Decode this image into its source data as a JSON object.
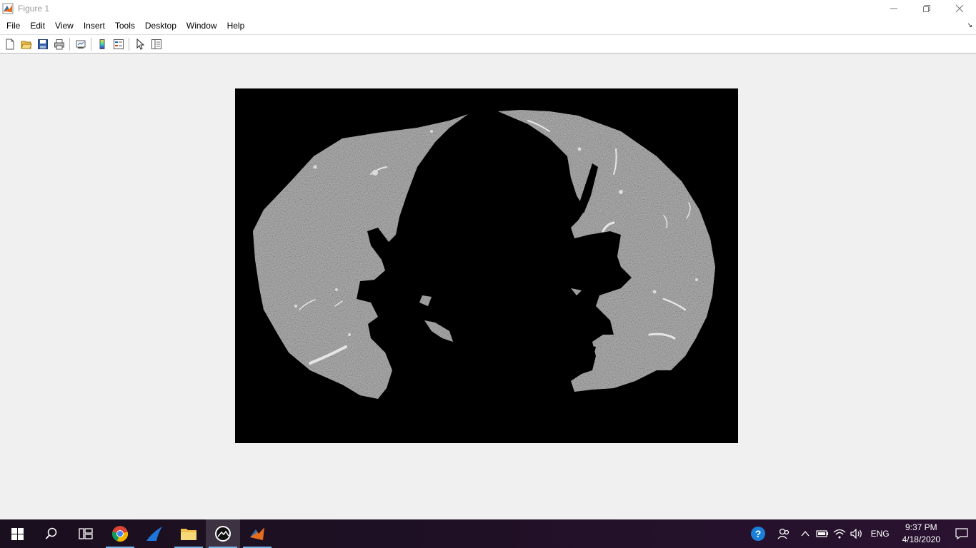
{
  "window": {
    "title": "Figure 1",
    "app_icon": "matlab-icon",
    "controls": [
      "minimize-icon",
      "restore-icon",
      "close-icon"
    ]
  },
  "menu": {
    "items": [
      {
        "label": "File"
      },
      {
        "label": "Edit"
      },
      {
        "label": "View"
      },
      {
        "label": "Insert"
      },
      {
        "label": "Tools"
      },
      {
        "label": "Desktop"
      },
      {
        "label": "Window"
      },
      {
        "label": "Help"
      }
    ]
  },
  "toolbar": {
    "buttons": [
      "new-figure-icon",
      "open-file-icon",
      "save-figure-icon",
      "print-figure-icon",
      "link-plot-icon",
      "insert-colorbar-icon",
      "insert-legend-icon",
      "edit-plot-icon",
      "open-property-inspector-icon"
    ]
  },
  "figure": {
    "content": "axial lung CT segmentation mask (grayscale)",
    "background": "#000000"
  },
  "taskbar": {
    "apps": [
      "windows-start-icon",
      "search-icon",
      "task-view-icon",
      "chrome-icon",
      "blue-app-icon",
      "file-explorer-icon",
      "image-app-icon",
      "matlab-icon"
    ],
    "tray": {
      "lang": "ENG",
      "time": "9:37 PM",
      "date": "4/18/2020"
    }
  },
  "colors": {
    "accent": "#76b9ed",
    "taskbar": "#1e1024"
  }
}
